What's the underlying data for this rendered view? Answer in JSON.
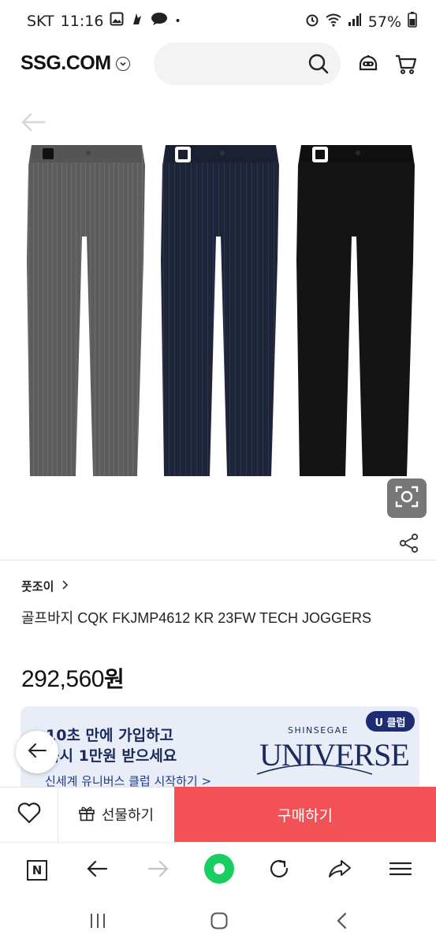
{
  "status_bar": {
    "carrier": "SKT",
    "time": "11:16",
    "battery": "57%"
  },
  "header": {
    "logo": "SSG.COM",
    "search_placeholder": ""
  },
  "product": {
    "brand": "풋조이",
    "title": "골프바지 CQK FKJMP4612 KR 23FW TECH JOGGERS",
    "price_number": "292,560",
    "price_unit": "원",
    "colors": [
      "#5d5d5d",
      "#1e2538",
      "#141414"
    ]
  },
  "banner": {
    "line1": "10초 만에 가입하고",
    "line2": "즉시 1만원 받으세요",
    "link": "신세계 유니버스 클럽 시작하기 >",
    "badge": "U 클럽",
    "brand_top": "SHINSEGAE",
    "brand_main": "UNIVERSE"
  },
  "action_bar": {
    "gift_label": "선물하기",
    "buy_label": "구매하기"
  },
  "browser_bar": {
    "n_label": "N"
  }
}
